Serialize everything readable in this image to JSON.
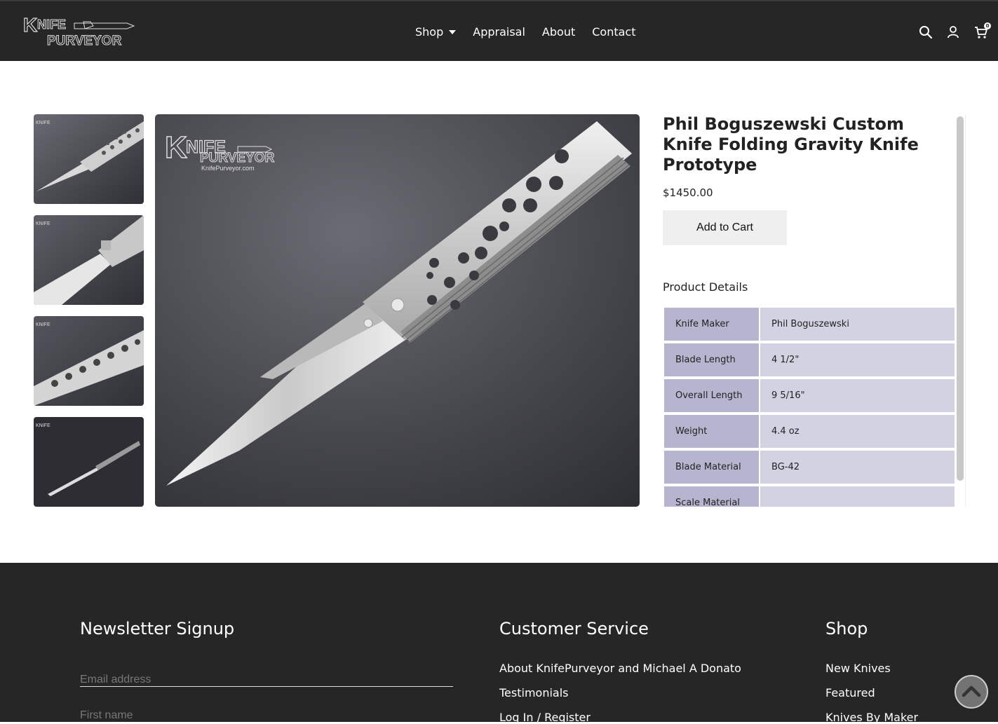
{
  "header": {
    "logo_alt": "Knife Purveyor",
    "nav": [
      {
        "label": "Shop"
      },
      {
        "label": "Appraisal"
      },
      {
        "label": "About"
      },
      {
        "label": "Contact"
      }
    ],
    "cart_count": "0",
    "icons": [
      "search-icon",
      "user-icon",
      "cart-icon"
    ]
  },
  "product": {
    "title": "Phil Boguszewski Custom Knife Folding Gravity Knife Prototype",
    "price": "$1450.00",
    "add_to_cart": "Add to Cart",
    "details_title": "Product Details",
    "specs": [
      {
        "key": "Knife Maker",
        "value": "Phil Boguszewski"
      },
      {
        "key": "Blade Length",
        "value": "4 1/2\""
      },
      {
        "key": "Overall Length",
        "value": "9 5/16\""
      },
      {
        "key": "Weight",
        "value": "4.4 oz"
      },
      {
        "key": "Blade Material",
        "value": "BG-42"
      },
      {
        "key": "Scale Material",
        "value": ""
      },
      {
        "key": "",
        "value": ""
      }
    ],
    "watermark": "KnifePurveyor.com"
  },
  "footer": {
    "newsletter": {
      "title": "Newsletter Signup",
      "email_placeholder": "Email address",
      "first_name_placeholder": "First name"
    },
    "customer_service": {
      "title": "Customer Service",
      "links": [
        "About KnifePurveyor and Michael A Donato",
        "Testimonials",
        "Log In / Register"
      ]
    },
    "shop": {
      "title": "Shop",
      "links": [
        "New Knives",
        "Featured",
        "Knives By Maker"
      ]
    }
  },
  "colors": {
    "header_bg": "#262626",
    "spec_key_bg": "#b6b5cf",
    "spec_value_bg": "#d3d2e2",
    "button_bg": "#efefef"
  }
}
